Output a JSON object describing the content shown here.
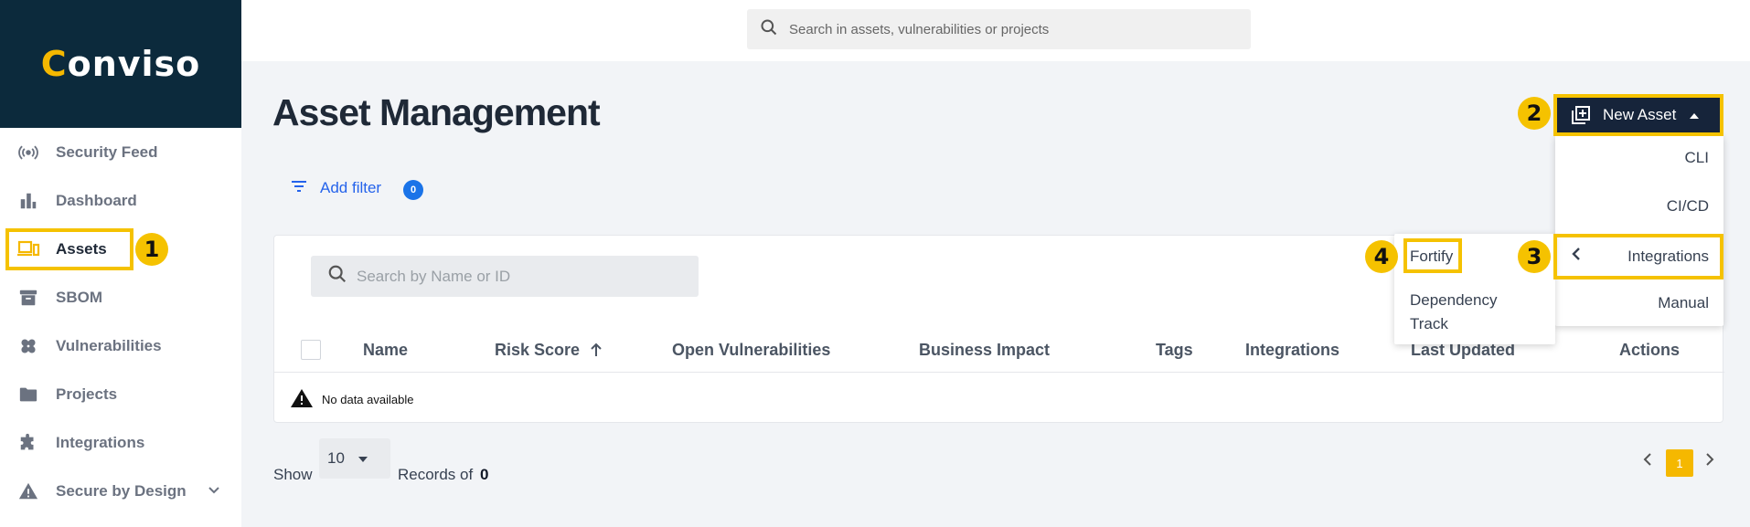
{
  "app": {
    "logo": "Conviso",
    "logo_c": "C",
    "logo_rest": "onviso"
  },
  "search": {
    "placeholder": "Search in assets, vulnerabilities or projects"
  },
  "sidebar": {
    "items": [
      {
        "label": "Security Feed",
        "icon": "radio-signal-icon"
      },
      {
        "label": "Dashboard",
        "icon": "bar-chart-icon"
      },
      {
        "label": "Assets",
        "icon": "devices-icon",
        "active": true
      },
      {
        "label": "SBOM",
        "icon": "archive-icon"
      },
      {
        "label": "Vulnerabilities",
        "icon": "bandage-icon"
      },
      {
        "label": "Projects",
        "icon": "folder-icon"
      },
      {
        "label": "Integrations",
        "icon": "puzzle-icon"
      },
      {
        "label": "Secure by Design",
        "icon": "warning-icon"
      }
    ]
  },
  "main": {
    "title": "Asset Management",
    "add_filter": "Add filter",
    "filter_count": "0",
    "table_search_placeholder": "Search by Name or ID",
    "columns": [
      "Name",
      "Risk Score",
      "Open Vulnerabilities",
      "Business Impact",
      "Tags",
      "Integrations",
      "Last Updated",
      "Actions"
    ],
    "no_data": "No data available",
    "show_label": "Show",
    "page_size": "10",
    "records_label": "Records of",
    "records_count": "0",
    "current_page": "1"
  },
  "new_asset": {
    "label": "New Asset",
    "menu": [
      "CLI",
      "CI/CD",
      "Integrations",
      "Manual"
    ],
    "submenu": [
      "Fortify",
      "Dependency Track"
    ]
  },
  "annotations": [
    "1",
    "2",
    "3",
    "4"
  ],
  "colors": {
    "accent": "#f5b800",
    "sidebar_header": "#0c2a3c",
    "button_dark": "#16243a",
    "link_blue": "#2563eb"
  }
}
